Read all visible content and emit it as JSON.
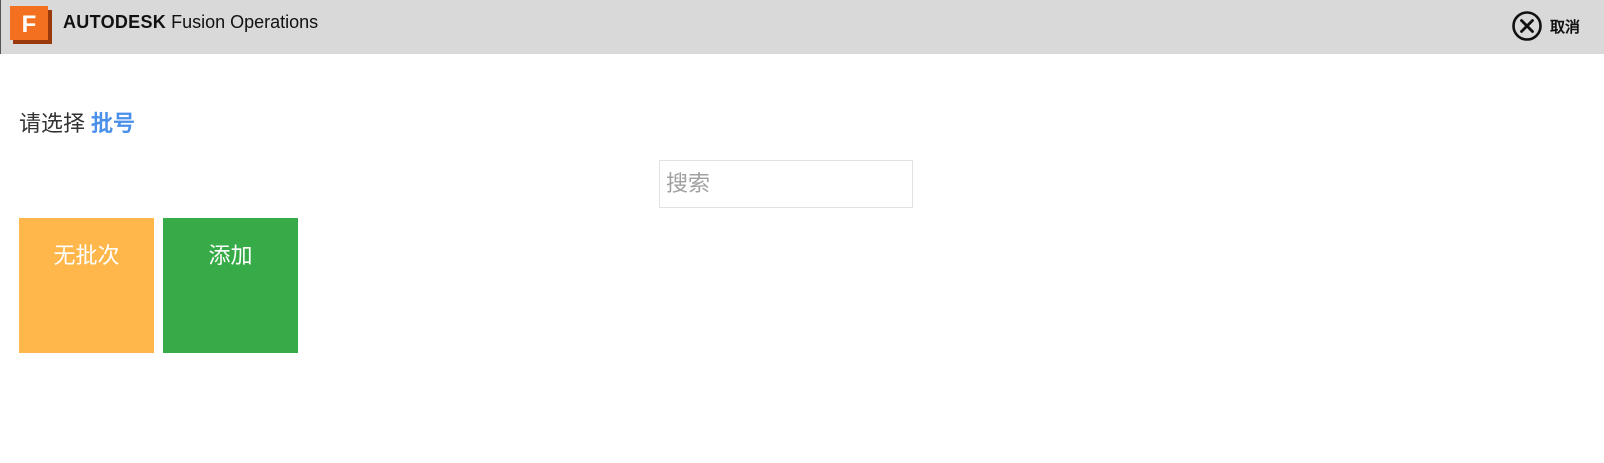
{
  "header": {
    "logo_letter": "F",
    "brand_strong": "AUTODESK",
    "brand_light": "Fusion Operations",
    "cancel_label": "取消",
    "cancel_icon": "close-circle-icon",
    "background": "#d9d9d9"
  },
  "main": {
    "prompt_text": "请选择",
    "prompt_accent": "批号",
    "accent_color": "#4a8fea",
    "search": {
      "placeholder": "搜索",
      "value": ""
    },
    "tiles": [
      {
        "label": "无批次",
        "color": "#ffb64a"
      },
      {
        "label": "添加",
        "color": "#37ab47"
      }
    ]
  }
}
